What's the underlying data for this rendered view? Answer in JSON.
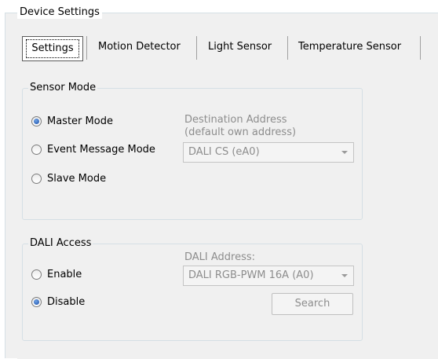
{
  "outer_group": {
    "title": "Device Settings"
  },
  "tabs": [
    {
      "label": "Settings",
      "selected": true
    },
    {
      "label": "Motion Detector",
      "selected": false
    },
    {
      "label": "Light Sensor",
      "selected": false
    },
    {
      "label": "Temperature Sensor",
      "selected": false
    }
  ],
  "sensor_mode": {
    "title": "Sensor Mode",
    "options": [
      {
        "label": "Master Mode",
        "checked": true
      },
      {
        "label": "Event Message Mode",
        "checked": false
      },
      {
        "label": "Slave Mode",
        "checked": false
      }
    ],
    "destination_label_line1": "Destination Address",
    "destination_label_line2": "(default own address)",
    "destination_value": "DALI CS (eA0)"
  },
  "dali_access": {
    "title": "DALI Access",
    "options": [
      {
        "label": "Enable",
        "checked": false
      },
      {
        "label": "Disable",
        "checked": true
      }
    ],
    "address_label": "DALI Address:",
    "address_value": "DALI RGB-PWM 16A (A0)",
    "search_label": "Search"
  },
  "colors": {
    "accent": "#1c4fa8",
    "disabled_text": "#8d8d8d",
    "border": "#d5dfe5"
  }
}
